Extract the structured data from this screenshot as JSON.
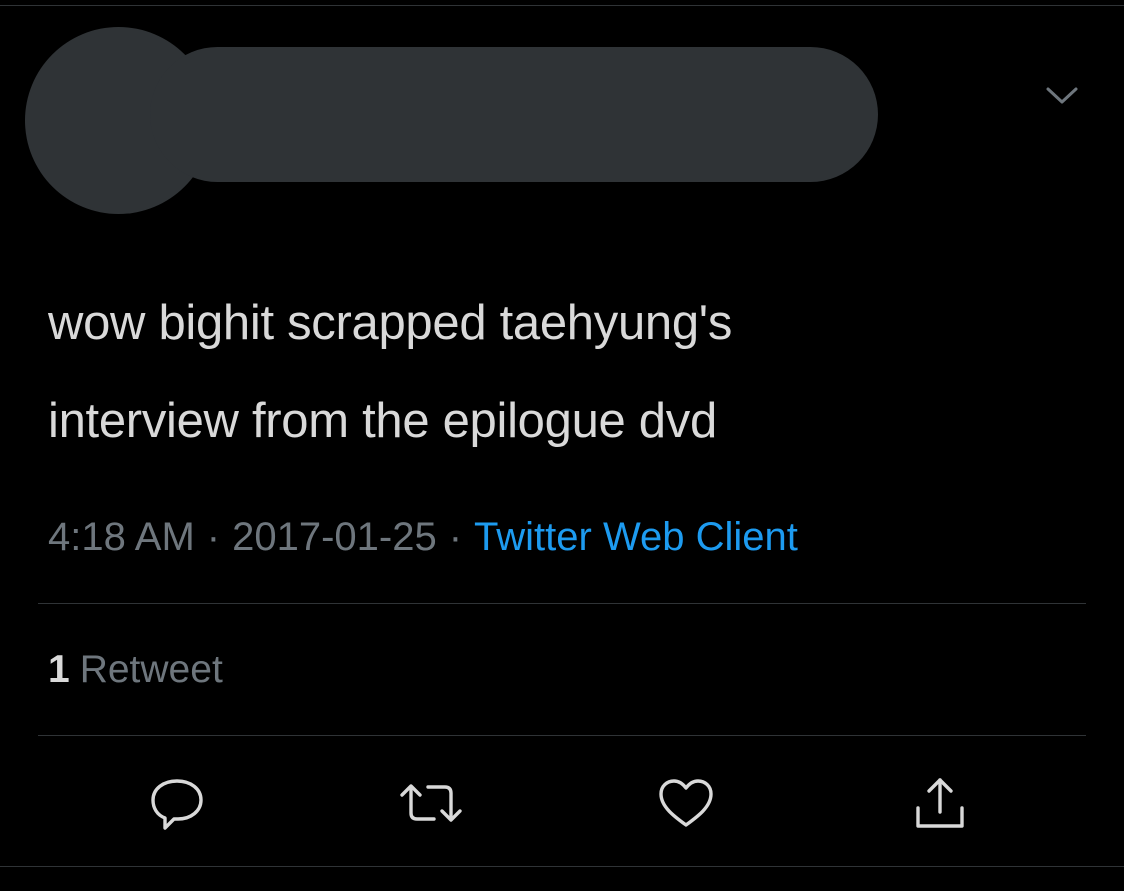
{
  "tweet": {
    "text": "wow bighit scrapped taehyung's interview from the epilogue dvd",
    "text_lines": [
      "wow bighit scrapped taehyung's",
      "interview from the epilogue dvd"
    ],
    "time": "4:18 AM",
    "separator": "·",
    "date": "2017-01-25",
    "source": "Twitter Web Client"
  },
  "stats": {
    "retweet_count": "1",
    "retweet_label": "Retweet"
  },
  "actions": [
    {
      "name": "reply",
      "icon": "reply-icon"
    },
    {
      "name": "retweet",
      "icon": "retweet-icon"
    },
    {
      "name": "like",
      "icon": "heart-icon"
    },
    {
      "name": "share",
      "icon": "share-icon"
    }
  ],
  "colors": {
    "background": "#000000",
    "text": "#d9d9d9",
    "secondary_text": "#6e767d",
    "link": "#1d9bf0",
    "redaction": "#2f3336",
    "divider": "#2f3336"
  }
}
